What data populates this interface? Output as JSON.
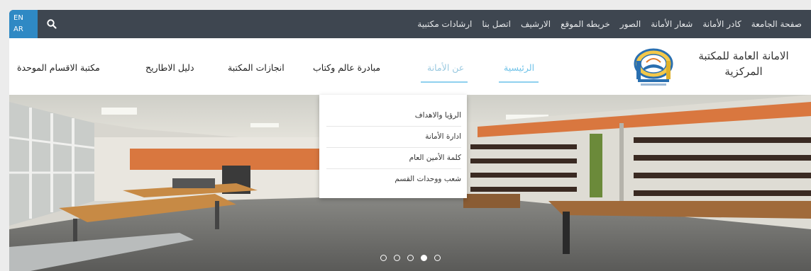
{
  "topbar": {
    "links": [
      "صفحة الجامعة",
      "كادر الأمانة",
      "شعار الأمانة",
      "الصور",
      "خريطه الموقع",
      "الارشيف",
      "اتصل بنا",
      "ارشادات مكتبية"
    ],
    "lang_en": "EN",
    "lang_ar": "AR",
    "search_icon": "search-icon"
  },
  "brand": {
    "line1": "الامانة العامة للمكتبة",
    "line2": "المركزية"
  },
  "nav": {
    "items": [
      "الرئيسية",
      "عن الأمانة",
      "مبادرة عالم وكتاب",
      "انجازات المكتبة",
      "دليل الاطاريح",
      "مكتبة الاقسام الموحدة"
    ]
  },
  "dropdown": {
    "items": [
      "الرؤيا والاهداف",
      "ادارة الأمانة",
      "كلمة الأمين العام",
      "شعب ووحدات القسم"
    ]
  },
  "slider": {
    "count": 5,
    "active_index": 3
  },
  "colors": {
    "topbar": "#3e4650",
    "lang_bg": "#2f89c4",
    "accent": "#6fc2e8"
  }
}
